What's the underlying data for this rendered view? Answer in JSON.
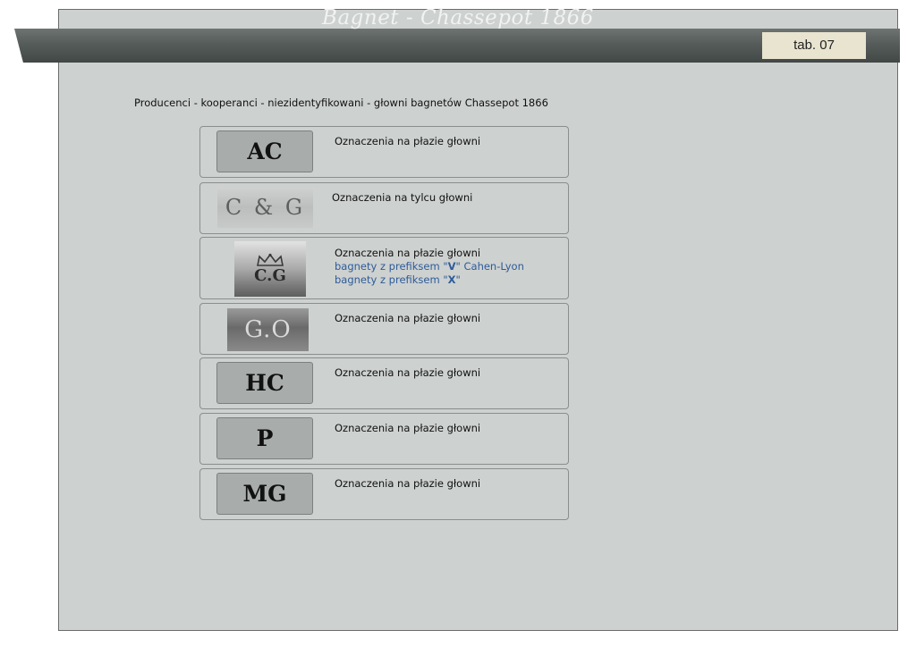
{
  "header": {
    "title": "Bagnet - Chassepot 1866",
    "tab_label": "tab. 07"
  },
  "subtitle": "Producenci - kooperanci - niezidentyfikowani - głowni bagnetów Chassepot 1866",
  "entries": [
    {
      "mark": "AC",
      "text": "Oznaczenia na płazie głowni"
    },
    {
      "mark": "C & G",
      "text": "Oznaczenia na tylcu głowni"
    },
    {
      "mark": "C.G",
      "text": "Oznaczenia na płazie głowni",
      "note1_pre": "bagnety z prefiksem \"",
      "note1_letter": "V",
      "note1_post": "\" Cahen-Lyon",
      "note2_pre": "bagnety z prefiksem \"",
      "note2_letter": "X",
      "note2_post": "\""
    },
    {
      "mark": "G.O",
      "text": "Oznaczenia na płazie głowni"
    },
    {
      "mark": "HC",
      "text": "Oznaczenia na płazie głowni"
    },
    {
      "mark": "P",
      "text": "Oznaczenia na płazie głowni"
    },
    {
      "mark": "MG",
      "text": "Oznaczenia na płazie głowni"
    }
  ]
}
